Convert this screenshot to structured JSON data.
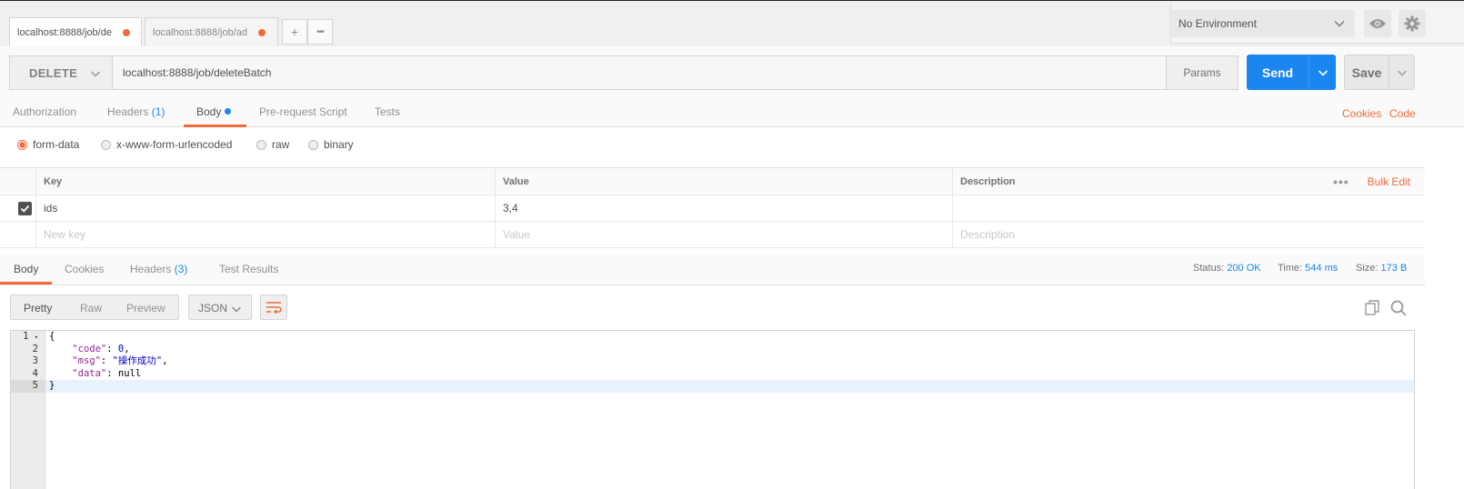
{
  "tabs": [
    {
      "label": "localhost:8888/job/de"
    },
    {
      "label": "localhost:8888/job/ad"
    }
  ],
  "tab_actions": {
    "add": "+",
    "more": "•••"
  },
  "environment": {
    "selected": "No Environment"
  },
  "request": {
    "method": "DELETE",
    "url": "localhost:8888/job/deleteBatch",
    "params_label": "Params",
    "send_label": "Send",
    "save_label": "Save"
  },
  "request_tabs": {
    "authorization": "Authorization",
    "headers": "Headers",
    "headers_count": "(1)",
    "body": "Body",
    "pre_request": "Pre-request Script",
    "tests": "Tests",
    "cookies": "Cookies",
    "code": "Code"
  },
  "body_types": {
    "form_data": "form-data",
    "urlencoded": "x-www-form-urlencoded",
    "raw": "raw",
    "binary": "binary",
    "selected": "form-data"
  },
  "kv_table": {
    "headers": {
      "key": "Key",
      "value": "Value",
      "description": "Description",
      "bulk_edit": "Bulk Edit"
    },
    "rows": [
      {
        "key": "ids",
        "value": "3,4",
        "description": "",
        "checked": true
      }
    ],
    "placeholders": {
      "key": "New key",
      "value": "Value",
      "description": "Description"
    }
  },
  "response_tabs": {
    "body": "Body",
    "cookies": "Cookies",
    "headers": "Headers",
    "headers_count": "(3)",
    "test_results": "Test Results"
  },
  "response_meta": {
    "status_label": "Status:",
    "status_value": "200 OK",
    "time_label": "Time:",
    "time_value": "544 ms",
    "size_label": "Size:",
    "size_value": "173 B"
  },
  "view_modes": {
    "pretty": "Pretty",
    "raw": "Raw",
    "preview": "Preview",
    "format": "JSON"
  },
  "response_body": {
    "line_numbers": [
      "1",
      "2",
      "3",
      "4",
      "5"
    ],
    "open_brace": "{",
    "close_brace": "}",
    "lines": [
      {
        "key": "\"code\"",
        "value": "0",
        "trail": ","
      },
      {
        "key": "\"msg\"",
        "value": "\"操作成功\"",
        "trail": ","
      },
      {
        "key": "\"data\"",
        "value": "null",
        "trail": ""
      }
    ]
  },
  "colors": {
    "accent": "#f26b3a",
    "send_blue": "#1b85f0"
  }
}
